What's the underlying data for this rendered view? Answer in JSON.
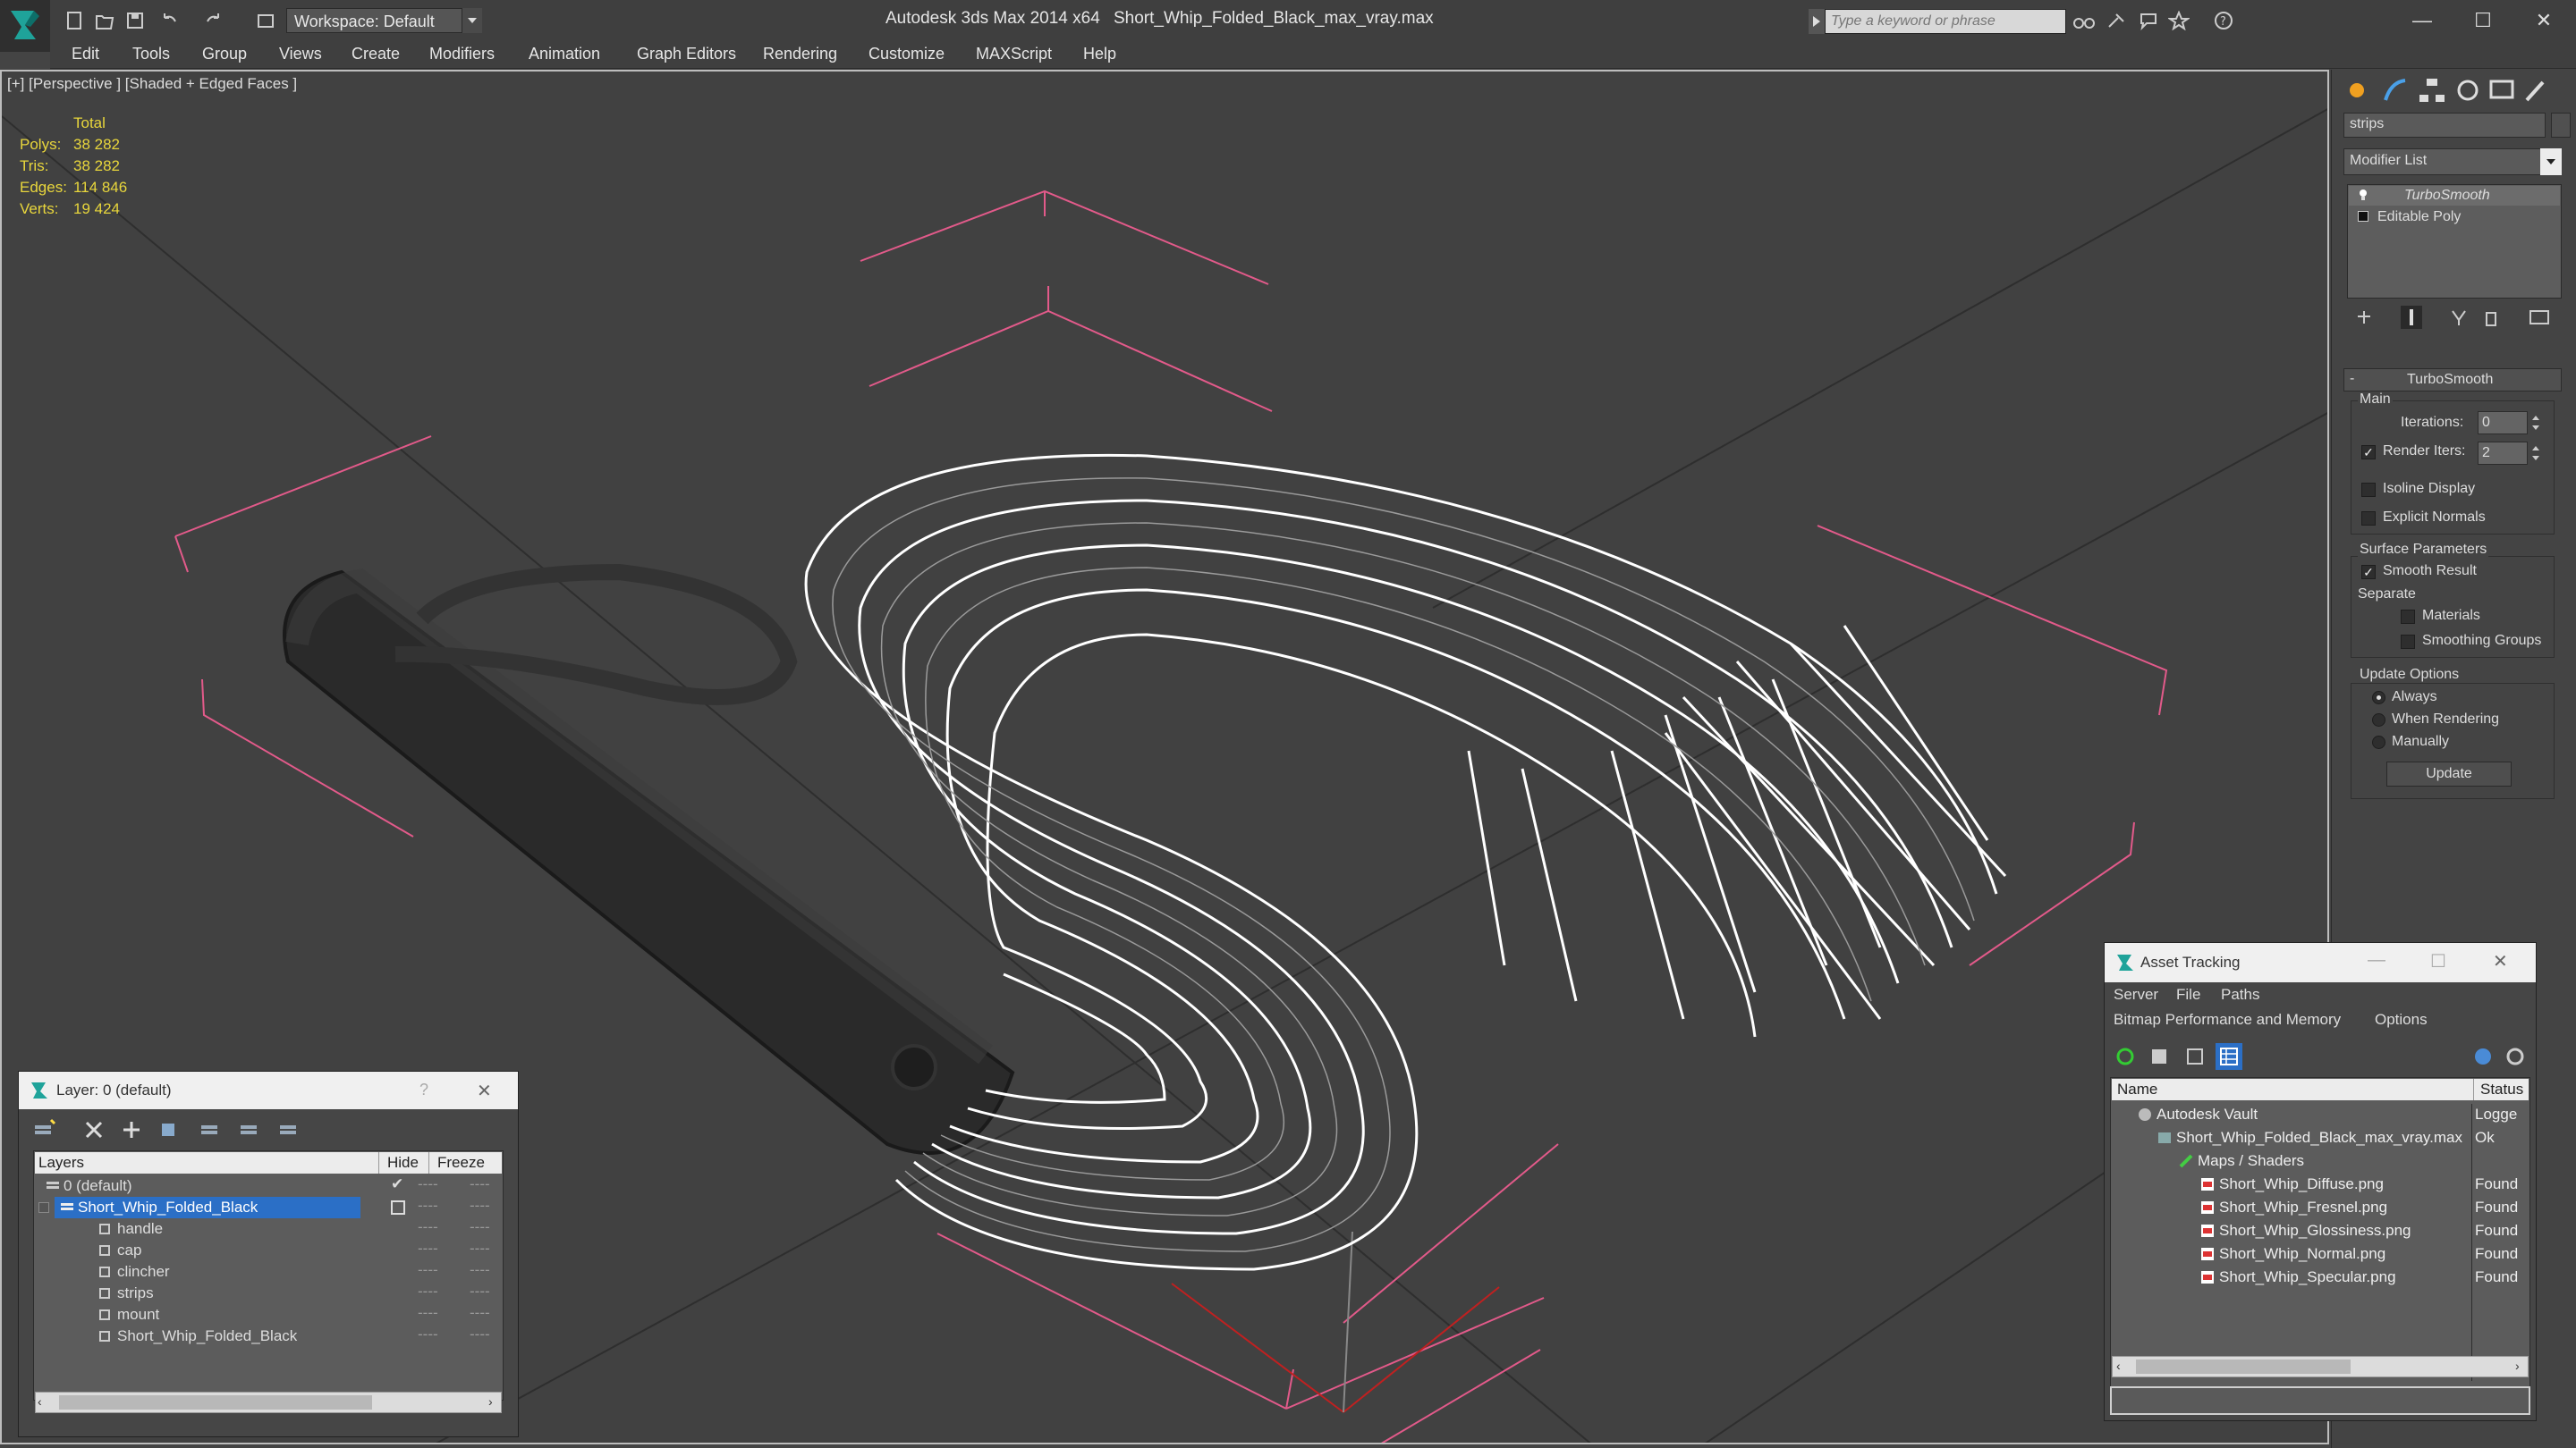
{
  "titlebar": {
    "workspace": "Workspace: Default",
    "app_title": "Autodesk 3ds Max  2014 x64",
    "file_title": "Short_Whip_Folded_Black_max_vray.max",
    "search_placeholder": "Type a keyword or phrase",
    "minimize": "—",
    "maximize": "☐",
    "close": "✕"
  },
  "menu": [
    "Edit",
    "Tools",
    "Group",
    "Views",
    "Create",
    "Modifiers",
    "Animation",
    "Graph Editors",
    "Rendering",
    "Customize",
    "MAXScript",
    "Help"
  ],
  "viewport": {
    "label": "[+] [Perspective ] [Shaded + Edged Faces ]",
    "stats": {
      "header": "Total",
      "rows": [
        {
          "label": "Polys:",
          "value": "38 282"
        },
        {
          "label": "Tris:",
          "value": "38 282"
        },
        {
          "label": "Edges:",
          "value": "114 846"
        },
        {
          "label": "Verts:",
          "value": "19 424"
        }
      ]
    }
  },
  "command_panel": {
    "object_name": "strips",
    "modifier_list": "Modifier List",
    "stack": [
      "TurboSmooth",
      "Editable Poly"
    ],
    "rollout_title": "TurboSmooth",
    "main_label": "Main",
    "iterations_label": "Iterations:",
    "iterations_value": "0",
    "render_iters_label": "Render Iters:",
    "render_iters_value": "2",
    "isoline_label": "Isoline Display",
    "explicit_normals_label": "Explicit Normals",
    "surface_params_label": "Surface Parameters",
    "smooth_result_label": "Smooth Result",
    "separate_label": "Separate",
    "materials_label": "Materials",
    "smoothing_groups_label": "Smoothing Groups",
    "update_options_label": "Update Options",
    "always_label": "Always",
    "when_rendering_label": "When Rendering",
    "manually_label": "Manually",
    "update_button": "Update",
    "collapse_sign": "-"
  },
  "layer_window": {
    "title": "Layer: 0 (default)",
    "help": "?",
    "close": "✕",
    "col_layers": "Layers",
    "col_hide": "Hide",
    "col_freeze": "Freeze",
    "rows": [
      {
        "name": "0 (default)",
        "indent": 1,
        "selected": false
      },
      {
        "name": "Short_Whip_Folded_Black",
        "indent": 1,
        "selected": true
      },
      {
        "name": "handle",
        "indent": 2,
        "selected": false
      },
      {
        "name": "cap",
        "indent": 2,
        "selected": false
      },
      {
        "name": "clincher",
        "indent": 2,
        "selected": false
      },
      {
        "name": "strips",
        "indent": 2,
        "selected": false
      },
      {
        "name": "mount",
        "indent": 2,
        "selected": false
      },
      {
        "name": "Short_Whip_Folded_Black",
        "indent": 2,
        "selected": false
      }
    ],
    "dash": "----"
  },
  "asset_window": {
    "title": "Asset Tracking",
    "menu1": [
      "Server",
      "File",
      "Paths"
    ],
    "menu2": [
      "Bitmap Performance and Memory",
      "Options"
    ],
    "col_name": "Name",
    "col_status": "Status",
    "rows": [
      {
        "name": "Autodesk Vault",
        "status": "Logge",
        "indent": 1,
        "icon": "vault-icon"
      },
      {
        "name": "Short_Whip_Folded_Black_max_vray.max",
        "status": "Ok",
        "indent": 2,
        "icon": "max-file-icon"
      },
      {
        "name": "Maps / Shaders",
        "status": "",
        "indent": 3,
        "icon": "maps-icon"
      },
      {
        "name": "Short_Whip_Diffuse.png",
        "status": "Found",
        "indent": 4,
        "icon": "png-icon"
      },
      {
        "name": "Short_Whip_Fresnel.png",
        "status": "Found",
        "indent": 4,
        "icon": "png-icon"
      },
      {
        "name": "Short_Whip_Glossiness.png",
        "status": "Found",
        "indent": 4,
        "icon": "png-icon"
      },
      {
        "name": "Short_Whip_Normal.png",
        "status": "Found",
        "indent": 4,
        "icon": "png-icon"
      },
      {
        "name": "Short_Whip_Specular.png",
        "status": "Found",
        "indent": 4,
        "icon": "png-icon"
      }
    ]
  },
  "colors": {
    "accent_selected": "#2b6fc6",
    "stats_yellow": "#e8d63c",
    "gizmo_pink": "#e25a8a"
  }
}
